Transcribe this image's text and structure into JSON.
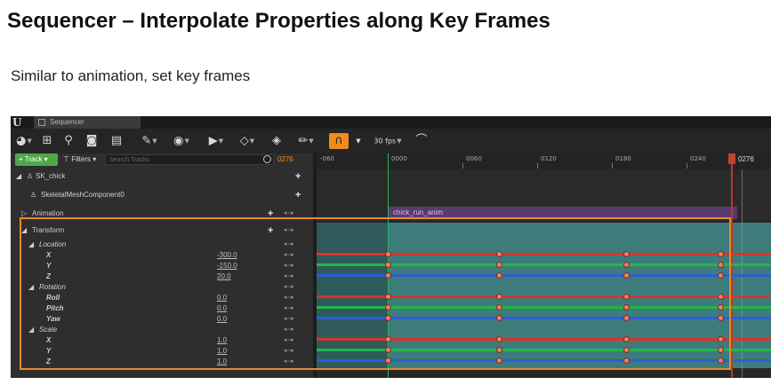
{
  "slide": {
    "title": "Sequencer – Interpolate Properties along Key Frames",
    "subtitle": "Similar to animation, set key frames"
  },
  "window": {
    "tab_label": "Sequencer"
  },
  "toolbar": {
    "fps_label": "30 fps"
  },
  "tracks_bar": {
    "track_button": "+ Track",
    "filters_label": "Filters",
    "search_placeholder": "Search Tracks",
    "current_frame": "0276"
  },
  "tree": {
    "actor": "SK_chick",
    "component": "SkeletalMeshComponent0",
    "animation": "Animation",
    "transform": "Transform",
    "location": "Location",
    "rotation": "Rotation",
    "scale": "Scale",
    "loc_x": "X",
    "loc_y": "Y",
    "loc_z": "Z",
    "rot_roll": "Roll",
    "rot_pitch": "Pitch",
    "rot_yaw": "Yaw",
    "scl_x": "X",
    "scl_y": "Y",
    "scl_z": "Z"
  },
  "values": {
    "loc_x": "-300.0",
    "loc_y": "-150.0",
    "loc_z": "20.0",
    "rot_roll": "0.0",
    "rot_pitch": "0.0",
    "rot_yaw": "0.0",
    "scl_x": "1.0",
    "scl_y": "1.0",
    "scl_z": "1.0"
  },
  "timeline": {
    "ticks": [
      "-060",
      "0000",
      "0060",
      "0120",
      "0180",
      "0240"
    ],
    "playhead_label": "0276",
    "animation_section_label": "chick_run_anim"
  },
  "colors": {
    "accent_orange": "#f28a1c",
    "track_green": "#4fa74c",
    "curve_red": "#d9332e",
    "curve_green": "#1fb84a",
    "curve_blue": "#2a5fd6",
    "key_fill": "#f07c64",
    "transform_lane": "#3e7c7c",
    "animation_section": "#5b3a6e"
  },
  "icons": [
    "unreal-logo-icon",
    "camera-icon",
    "film-icon",
    "play-icon",
    "key-icon",
    "magnet-icon",
    "curve-icon"
  ]
}
